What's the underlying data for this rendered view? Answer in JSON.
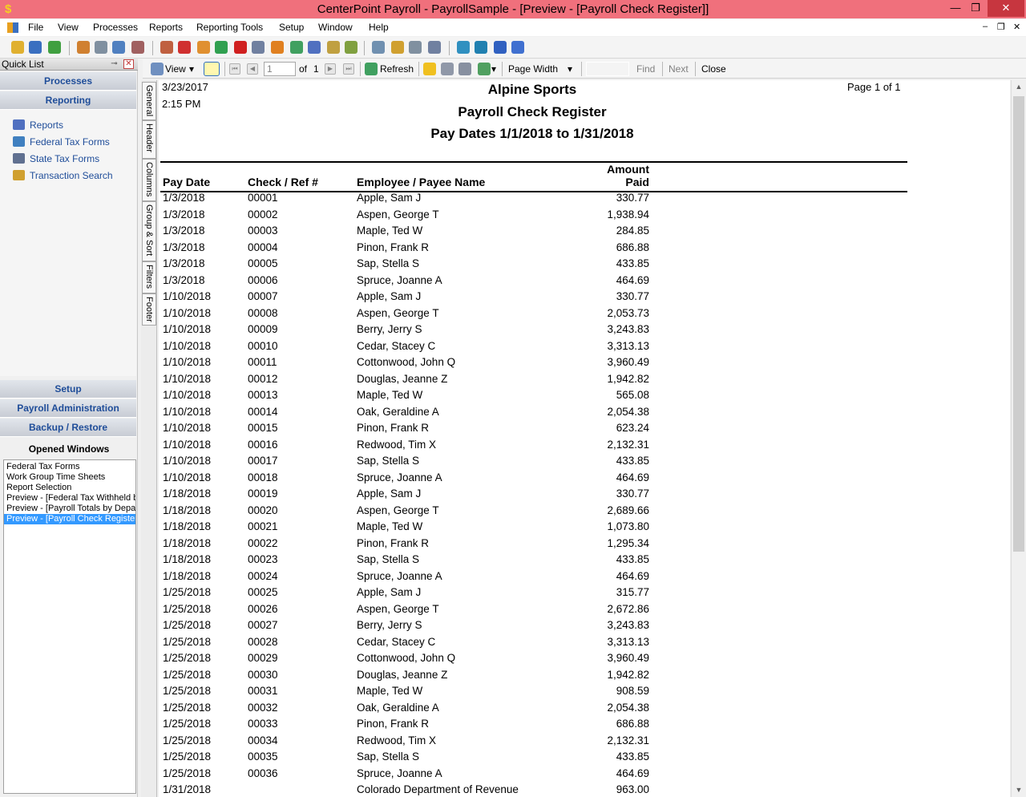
{
  "window": {
    "title": "CenterPoint Payroll - PayrollSample - [Preview - [Payroll Check Register]]",
    "app_icon_glyph": "$",
    "minimize_glyph": "—",
    "maximize_glyph": "❐",
    "close_glyph": "✕"
  },
  "menu": {
    "items": [
      "File",
      "View",
      "Processes",
      "Reports",
      "Reporting Tools",
      "Setup",
      "Window",
      "Help"
    ],
    "mdi_minimize": "–",
    "mdi_restore": "❐",
    "mdi_close": "✕"
  },
  "toolbar_icons": [
    {
      "name": "open-folder-icon",
      "color": "#e0b030"
    },
    {
      "name": "book-icon",
      "color": "#3a6fc0"
    },
    {
      "name": "refresh-icon",
      "color": "#40a040"
    },
    {
      "name": "users-icon",
      "color": "#d08030"
    },
    {
      "name": "printer-icon",
      "color": "#8090a0"
    },
    {
      "name": "calculator-icon",
      "color": "#5080c0"
    },
    {
      "name": "tools-icon",
      "color": "#a06060"
    },
    {
      "name": "people-group-icon",
      "color": "#c06040"
    },
    {
      "name": "red-doc-icon",
      "color": "#d03030"
    },
    {
      "name": "checks-icon",
      "color": "#e09030"
    },
    {
      "name": "dollar-icon",
      "color": "#30a050"
    },
    {
      "name": "stop-icon",
      "color": "#d02020"
    },
    {
      "name": "register-icon",
      "color": "#7080a0"
    },
    {
      "name": "clock-icon",
      "color": "#e08020"
    },
    {
      "name": "tax-icon",
      "color": "#40a060"
    },
    {
      "name": "form-icon",
      "color": "#5070c0"
    },
    {
      "name": "handshake-icon",
      "color": "#c0a040"
    },
    {
      "name": "handshake2-icon",
      "color": "#80a040"
    },
    {
      "name": "report-setup-icon",
      "color": "#7090b0"
    },
    {
      "name": "key-icon",
      "color": "#d0a030"
    },
    {
      "name": "lock-icon",
      "color": "#8090a0"
    },
    {
      "name": "lock2-icon",
      "color": "#7080a0"
    },
    {
      "name": "globe-icon",
      "color": "#3090c0"
    },
    {
      "name": "globe2-icon",
      "color": "#2080b0"
    },
    {
      "name": "help-icon",
      "color": "#3060c0"
    },
    {
      "name": "info-icon",
      "color": "#4070d0"
    }
  ],
  "sidebar": {
    "quick_list_title": "Quick List",
    "pin_glyph": "⊸",
    "close_glyph": "✕",
    "top_sections": [
      "Processes",
      "Reporting"
    ],
    "reporting_items": [
      {
        "label": "Reports",
        "icon": "reports-icon",
        "color": "#5070c0"
      },
      {
        "label": "Federal Tax Forms",
        "icon": "federal-tax-forms-icon",
        "color": "#4080c0"
      },
      {
        "label": "State Tax Forms",
        "icon": "state-tax-forms-icon",
        "color": "#607090"
      },
      {
        "label": "Transaction Search",
        "icon": "transaction-search-icon",
        "color": "#d0a030"
      }
    ],
    "bottom_sections": [
      "Setup",
      "Payroll Administration",
      "Backup / Restore"
    ],
    "opened_windows_title": "Opened Windows",
    "opened_windows": [
      "Federal Tax Forms",
      "Work Group Time Sheets",
      "Report Selection",
      "Preview - [Federal Tax Withheld b",
      "Preview - [Payroll Totals by Depart",
      "Preview - [Payroll Check Register"
    ],
    "selected_window_index": 5
  },
  "preview_toolbar": {
    "view_label": "View",
    "dropdown_glyph": "▾",
    "first_glyph": "⏮",
    "prev_glyph": "◀",
    "next_glyph": "▶",
    "last_glyph": "⏭",
    "page_value": "1",
    "of_label": "of",
    "page_total": "1",
    "refresh_label": "Refresh",
    "zoom_label": "Page Width",
    "find_label": "Find",
    "next_label": "Next",
    "close_label": "Close"
  },
  "side_tabs": [
    "General",
    "Header",
    "Columns",
    "Group & Sort",
    "Filters",
    "Footer"
  ],
  "report": {
    "date": "3/23/2017",
    "time": "2:15 PM",
    "page_label": "Page 1 of 1",
    "company": "Alpine Sports",
    "title": "Payroll Check Register",
    "subtitle": "Pay Dates 1/1/2018 to 1/31/2018",
    "columns": {
      "pay_date": "Pay Date",
      "check": "Check / Ref #",
      "name": "Employee / Payee Name",
      "amount_line1": "Amount",
      "amount_line2": "Paid"
    },
    "rows": [
      {
        "date": "1/3/2018",
        "check": "00001",
        "name": "Apple, Sam J",
        "amount": "330.77"
      },
      {
        "date": "1/3/2018",
        "check": "00002",
        "name": "Aspen, George T",
        "amount": "1,938.94"
      },
      {
        "date": "1/3/2018",
        "check": "00003",
        "name": "Maple, Ted W",
        "amount": "284.85"
      },
      {
        "date": "1/3/2018",
        "check": "00004",
        "name": "Pinon, Frank R",
        "amount": "686.88"
      },
      {
        "date": "1/3/2018",
        "check": "00005",
        "name": "Sap, Stella S",
        "amount": "433.85"
      },
      {
        "date": "1/3/2018",
        "check": "00006",
        "name": "Spruce, Joanne A",
        "amount": "464.69"
      },
      {
        "date": "1/10/2018",
        "check": "00007",
        "name": "Apple, Sam J",
        "amount": "330.77"
      },
      {
        "date": "1/10/2018",
        "check": "00008",
        "name": "Aspen, George T",
        "amount": "2,053.73"
      },
      {
        "date": "1/10/2018",
        "check": "00009",
        "name": "Berry, Jerry S",
        "amount": "3,243.83"
      },
      {
        "date": "1/10/2018",
        "check": "00010",
        "name": "Cedar, Stacey C",
        "amount": "3,313.13"
      },
      {
        "date": "1/10/2018",
        "check": "00011",
        "name": "Cottonwood, John Q",
        "amount": "3,960.49"
      },
      {
        "date": "1/10/2018",
        "check": "00012",
        "name": "Douglas, Jeanne Z",
        "amount": "1,942.82"
      },
      {
        "date": "1/10/2018",
        "check": "00013",
        "name": "Maple, Ted W",
        "amount": "565.08"
      },
      {
        "date": "1/10/2018",
        "check": "00014",
        "name": "Oak, Geraldine A",
        "amount": "2,054.38"
      },
      {
        "date": "1/10/2018",
        "check": "00015",
        "name": "Pinon, Frank R",
        "amount": "623.24"
      },
      {
        "date": "1/10/2018",
        "check": "00016",
        "name": "Redwood, Tim X",
        "amount": "2,132.31"
      },
      {
        "date": "1/10/2018",
        "check": "00017",
        "name": "Sap, Stella S",
        "amount": "433.85"
      },
      {
        "date": "1/10/2018",
        "check": "00018",
        "name": "Spruce, Joanne A",
        "amount": "464.69"
      },
      {
        "date": "1/18/2018",
        "check": "00019",
        "name": "Apple, Sam J",
        "amount": "330.77"
      },
      {
        "date": "1/18/2018",
        "check": "00020",
        "name": "Aspen, George T",
        "amount": "2,689.66"
      },
      {
        "date": "1/18/2018",
        "check": "00021",
        "name": "Maple, Ted W",
        "amount": "1,073.80"
      },
      {
        "date": "1/18/2018",
        "check": "00022",
        "name": "Pinon, Frank R",
        "amount": "1,295.34"
      },
      {
        "date": "1/18/2018",
        "check": "00023",
        "name": "Sap, Stella S",
        "amount": "433.85"
      },
      {
        "date": "1/18/2018",
        "check": "00024",
        "name": "Spruce, Joanne A",
        "amount": "464.69"
      },
      {
        "date": "1/25/2018",
        "check": "00025",
        "name": "Apple, Sam J",
        "amount": "315.77"
      },
      {
        "date": "1/25/2018",
        "check": "00026",
        "name": "Aspen, George T",
        "amount": "2,672.86"
      },
      {
        "date": "1/25/2018",
        "check": "00027",
        "name": "Berry, Jerry S",
        "amount": "3,243.83"
      },
      {
        "date": "1/25/2018",
        "check": "00028",
        "name": "Cedar, Stacey C",
        "amount": "3,313.13"
      },
      {
        "date": "1/25/2018",
        "check": "00029",
        "name": "Cottonwood, John Q",
        "amount": "3,960.49"
      },
      {
        "date": "1/25/2018",
        "check": "00030",
        "name": "Douglas, Jeanne Z",
        "amount": "1,942.82"
      },
      {
        "date": "1/25/2018",
        "check": "00031",
        "name": "Maple, Ted W",
        "amount": "908.59"
      },
      {
        "date": "1/25/2018",
        "check": "00032",
        "name": "Oak, Geraldine A",
        "amount": "2,054.38"
      },
      {
        "date": "1/25/2018",
        "check": "00033",
        "name": "Pinon, Frank R",
        "amount": "686.88"
      },
      {
        "date": "1/25/2018",
        "check": "00034",
        "name": "Redwood, Tim X",
        "amount": "2,132.31"
      },
      {
        "date": "1/25/2018",
        "check": "00035",
        "name": "Sap, Stella S",
        "amount": "433.85"
      },
      {
        "date": "1/25/2018",
        "check": "00036",
        "name": "Spruce, Joanne A",
        "amount": "464.69"
      },
      {
        "date": "1/31/2018",
        "check": "",
        "name": "Colorado Department of Revenue",
        "amount": "963.00"
      }
    ]
  },
  "scrollbar": {
    "up_glyph": "▲",
    "down_glyph": "▼"
  }
}
